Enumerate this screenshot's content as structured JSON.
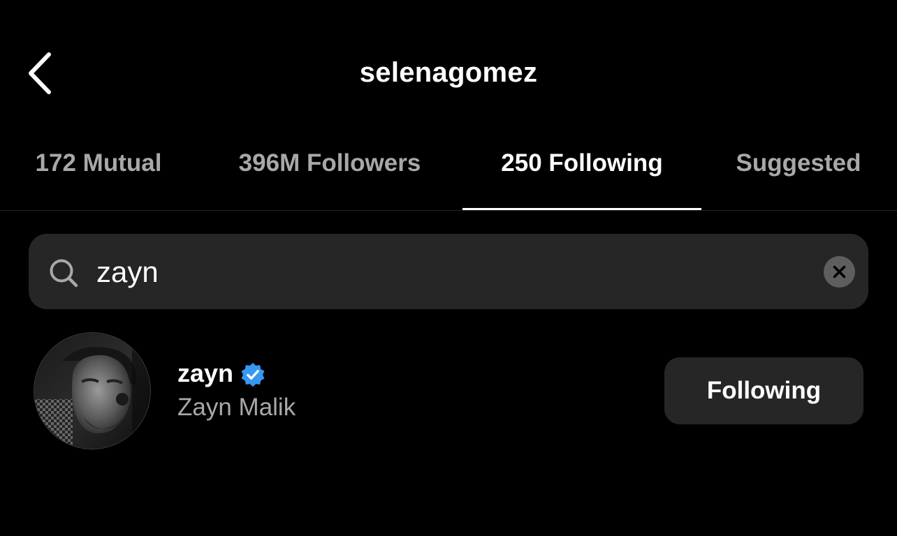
{
  "header": {
    "back_icon": "chevron-left-icon",
    "title": "selenagomez"
  },
  "tabs": [
    {
      "label": "172 Mutual",
      "active": false
    },
    {
      "label": "396M Followers",
      "active": false
    },
    {
      "label": "250 Following",
      "active": true
    },
    {
      "label": "Suggested",
      "active": false
    }
  ],
  "search": {
    "icon": "search-icon",
    "value": "zayn",
    "clear_icon": "clear-icon"
  },
  "results": [
    {
      "username": "zayn",
      "verified": true,
      "full_name": "Zayn Malik",
      "button_label": "Following"
    }
  ],
  "colors": {
    "background": "#000000",
    "text_primary": "#ffffff",
    "text_secondary": "#a8a8a8",
    "surface": "#262626",
    "verified_blue": "#3897f0"
  }
}
